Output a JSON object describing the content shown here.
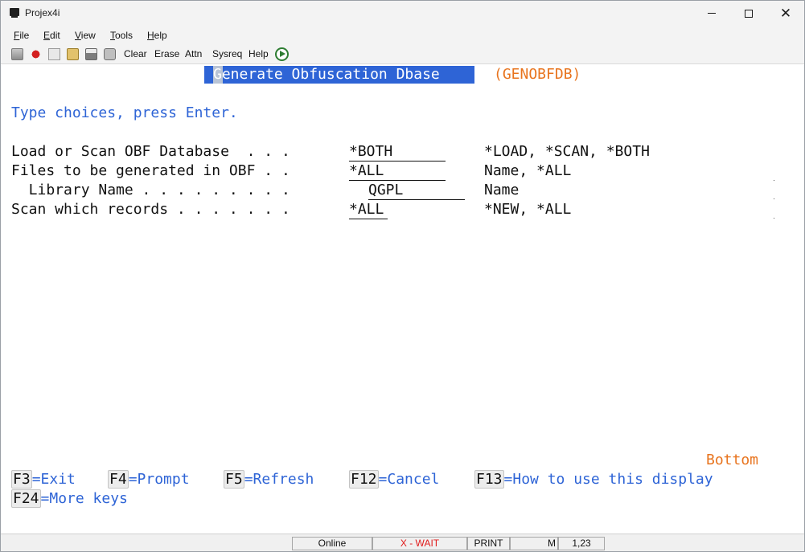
{
  "window": {
    "title": "Projex4i"
  },
  "menu": [
    {
      "label": "File",
      "ul": "F",
      "rest": "ile"
    },
    {
      "label": "Edit",
      "ul": "E",
      "rest": "dit"
    },
    {
      "label": "View",
      "ul": "V",
      "rest": "iew"
    },
    {
      "label": "Tools",
      "ul": "T",
      "rest": "ools"
    },
    {
      "label": "Help",
      "ul": "H",
      "rest": "elp"
    }
  ],
  "toolbar": {
    "icons": [
      "disconnect-icon",
      "stop-icon",
      "copy-icon",
      "paste-icon",
      "print-icon",
      "screenshot-icon"
    ],
    "clear": "Clear",
    "erase": "Erase",
    "attn": "Attn",
    "sysreq": "Sysreq",
    "help": "Help",
    "run_icon": "play-icon"
  },
  "screen": {
    "title_first": "G",
    "title_rest": "enerate Obfuscation Dbase",
    "program": "(GENOBFDB)",
    "instruction": "Type choices, press Enter.",
    "fields": [
      {
        "label": "Load or Scan OBF Database  . . .",
        "value": "*BOTH",
        "hint": "*LOAD, *SCAN, *BOTH"
      },
      {
        "label": "Files to be generated in OBF . .",
        "value": "*ALL",
        "hint": "Name, *ALL"
      },
      {
        "label": "  Library Name . . . . . . . . .",
        "value": "QGPL",
        "hint": "Name"
      },
      {
        "label": "Scan which records . . . . . . .",
        "value": "*ALL",
        "hint": "*NEW, *ALL"
      }
    ],
    "more": "Bottom",
    "fkeys": [
      {
        "key": "F3",
        "desc": "=Exit"
      },
      {
        "key": "F4",
        "desc": "=Prompt"
      },
      {
        "key": "F5",
        "desc": "=Refresh"
      },
      {
        "key": "F12",
        "desc": "=Cancel"
      },
      {
        "key": "F13",
        "desc": "=How to use this display"
      },
      {
        "key": "F24",
        "desc": "=More keys"
      }
    ]
  },
  "status": {
    "online": "Online",
    "wait": "X - WAIT",
    "print": "PRINT",
    "mode": "M",
    "cursor": "1,23"
  },
  "colors": {
    "field_text": "#2e64d6",
    "highlight": "#e8741e",
    "title_bg": "#2e64d6"
  }
}
